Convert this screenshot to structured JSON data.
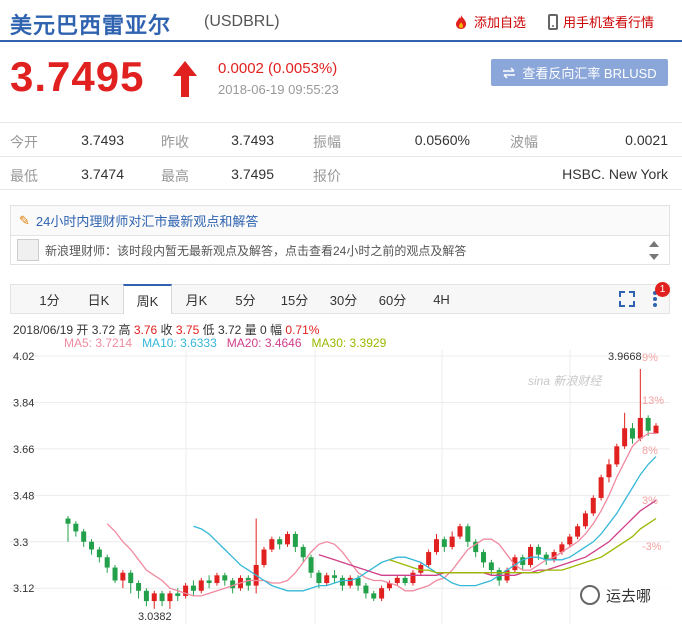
{
  "header": {
    "title": "美元巴西雷亚尔",
    "code": "(USDBRL)",
    "add_watchlist": "添加自选",
    "mobile_view": "用手机查看行情"
  },
  "quote": {
    "price": "3.7495",
    "change": "0.0002 (0.0053%)",
    "time": "2018-06-19 09:55:23",
    "reverse_button": "查看反向汇率 BRLUSD",
    "up_color": "#e0211f"
  },
  "stats": {
    "rows": [
      [
        {
          "label": "今开",
          "value": "3.7493"
        },
        {
          "label": "昨收",
          "value": "3.7493"
        },
        {
          "label": "振幅",
          "value": "0.0560%"
        },
        {
          "label": "波幅",
          "value": "0.0021"
        }
      ],
      [
        {
          "label": "最低",
          "value": "3.7474"
        },
        {
          "label": "最高",
          "value": "3.7495"
        },
        {
          "label": "报价",
          "value": "HSBC. New York"
        }
      ]
    ]
  },
  "opinions": {
    "heading": "24小时内理财师对汇市最新观点和解答",
    "message": "新浪理财师：该时段内暂无最新观点及解答，点击查看24小时之前的观点及解答"
  },
  "tabs": {
    "items": [
      "1分",
      "日K",
      "周K",
      "月K",
      "5分",
      "15分",
      "30分",
      "60分",
      "4H"
    ],
    "active": "周K",
    "badge": "1"
  },
  "kline_info": {
    "date": "2018/06/19",
    "open_label": "开",
    "open": "3.72",
    "high_label": "高",
    "high": "3.76",
    "close_label": "收",
    "close": "3.75",
    "low_label": "低",
    "low": "3.72",
    "vol_label": "量",
    "vol": "0",
    "amp_label": "幅",
    "amp": "0.71%",
    "ma5": "MA5: 3.7214",
    "ma10": "MA10: 3.6333",
    "ma20": "MA20: 3.4646",
    "ma30": "MA30: 3.3929",
    "ma_colors": {
      "ma5": "#f08aa0",
      "ma10": "#36b8d8",
      "ma20": "#d0408a",
      "ma30": "#9ab800"
    }
  },
  "watermark": {
    "brand": "sina 新浪财经",
    "account": "运去哪"
  },
  "chart_data": {
    "type": "candlestick",
    "title": "",
    "y_ticks": [
      "4.02",
      "3.84",
      "3.66",
      "3.48",
      "3.3",
      "3.12"
    ],
    "y_range": [
      3.02,
      4.02
    ],
    "right_ticks": [
      "9%",
      "13%",
      "8%",
      "3%",
      "-3%"
    ],
    "high_label": "3.9668",
    "low_label": "3.0382",
    "up_color": "#e0211f",
    "down_color": "#22a04a",
    "candles": [
      [
        3.39,
        3.37,
        3.4,
        3.3
      ],
      [
        3.37,
        3.34,
        3.38,
        3.32
      ],
      [
        3.34,
        3.3,
        3.35,
        3.28
      ],
      [
        3.3,
        3.27,
        3.31,
        3.25
      ],
      [
        3.27,
        3.24,
        3.28,
        3.22
      ],
      [
        3.24,
        3.2,
        3.25,
        3.18
      ],
      [
        3.2,
        3.15,
        3.21,
        3.14
      ],
      [
        3.15,
        3.18,
        3.19,
        3.12
      ],
      [
        3.18,
        3.14,
        3.19,
        3.1
      ],
      [
        3.14,
        3.11,
        3.15,
        3.08
      ],
      [
        3.11,
        3.07,
        3.12,
        3.05
      ],
      [
        3.07,
        3.1,
        3.11,
        3.04
      ],
      [
        3.1,
        3.07,
        3.11,
        3.05
      ],
      [
        3.07,
        3.1,
        3.11,
        3.04
      ],
      [
        3.1,
        3.09,
        3.12,
        3.07
      ],
      [
        3.09,
        3.13,
        3.14,
        3.08
      ],
      [
        3.13,
        3.11,
        3.15,
        3.09
      ],
      [
        3.11,
        3.15,
        3.16,
        3.1
      ],
      [
        3.15,
        3.14,
        3.17,
        3.12
      ],
      [
        3.14,
        3.17,
        3.18,
        3.13
      ],
      [
        3.17,
        3.15,
        3.18,
        3.13
      ],
      [
        3.15,
        3.12,
        3.16,
        3.1
      ],
      [
        3.12,
        3.16,
        3.17,
        3.11
      ],
      [
        3.16,
        3.13,
        3.17,
        3.11
      ],
      [
        3.13,
        3.21,
        3.39,
        3.1
      ],
      [
        3.21,
        3.27,
        3.28,
        3.2
      ],
      [
        3.27,
        3.31,
        3.32,
        3.26
      ],
      [
        3.31,
        3.29,
        3.32,
        3.27
      ],
      [
        3.29,
        3.33,
        3.34,
        3.28
      ],
      [
        3.33,
        3.28,
        3.34,
        3.26
      ],
      [
        3.28,
        3.24,
        3.29,
        3.22
      ],
      [
        3.24,
        3.18,
        3.25,
        3.16
      ],
      [
        3.18,
        3.14,
        3.19,
        3.12
      ],
      [
        3.14,
        3.17,
        3.18,
        3.13
      ],
      [
        3.17,
        3.16,
        3.19,
        3.14
      ],
      [
        3.16,
        3.13,
        3.17,
        3.11
      ],
      [
        3.13,
        3.16,
        3.17,
        3.12
      ],
      [
        3.16,
        3.13,
        3.17,
        3.11
      ],
      [
        3.13,
        3.1,
        3.14,
        3.08
      ],
      [
        3.1,
        3.08,
        3.11,
        3.07
      ],
      [
        3.08,
        3.12,
        3.13,
        3.07
      ],
      [
        3.12,
        3.14,
        3.15,
        3.11
      ],
      [
        3.14,
        3.16,
        3.17,
        3.13
      ],
      [
        3.16,
        3.14,
        3.17,
        3.13
      ],
      [
        3.14,
        3.18,
        3.19,
        3.13
      ],
      [
        3.18,
        3.21,
        3.22,
        3.17
      ],
      [
        3.21,
        3.26,
        3.27,
        3.2
      ],
      [
        3.26,
        3.31,
        3.33,
        3.25
      ],
      [
        3.31,
        3.28,
        3.32,
        3.26
      ],
      [
        3.28,
        3.32,
        3.34,
        3.27
      ],
      [
        3.32,
        3.36,
        3.37,
        3.31
      ],
      [
        3.36,
        3.3,
        3.37,
        3.28
      ],
      [
        3.3,
        3.26,
        3.31,
        3.24
      ],
      [
        3.26,
        3.22,
        3.27,
        3.2
      ],
      [
        3.22,
        3.19,
        3.23,
        3.17
      ],
      [
        3.19,
        3.15,
        3.2,
        3.13
      ],
      [
        3.15,
        3.19,
        3.2,
        3.14
      ],
      [
        3.19,
        3.24,
        3.25,
        3.18
      ],
      [
        3.24,
        3.21,
        3.25,
        3.19
      ],
      [
        3.21,
        3.28,
        3.29,
        3.2
      ],
      [
        3.28,
        3.25,
        3.29,
        3.23
      ],
      [
        3.25,
        3.23,
        3.26,
        3.21
      ],
      [
        3.23,
        3.26,
        3.27,
        3.22
      ],
      [
        3.26,
        3.29,
        3.3,
        3.25
      ],
      [
        3.29,
        3.32,
        3.33,
        3.28
      ],
      [
        3.32,
        3.36,
        3.37,
        3.31
      ],
      [
        3.36,
        3.41,
        3.42,
        3.35
      ],
      [
        3.41,
        3.47,
        3.48,
        3.4
      ],
      [
        3.47,
        3.55,
        3.56,
        3.46
      ],
      [
        3.55,
        3.6,
        3.62,
        3.53
      ],
      [
        3.6,
        3.67,
        3.68,
        3.59
      ],
      [
        3.67,
        3.74,
        3.8,
        3.66
      ],
      [
        3.74,
        3.7,
        3.76,
        3.68
      ],
      [
        3.7,
        3.78,
        3.97,
        3.69
      ],
      [
        3.78,
        3.73,
        3.79,
        3.71
      ],
      [
        3.72,
        3.75,
        3.76,
        3.72
      ]
    ],
    "ma_lines": {
      "MA5": [
        3.37,
        3.34,
        3.3,
        3.27,
        3.23,
        3.19,
        3.17,
        3.15,
        3.12,
        3.11,
        3.1,
        3.09,
        3.09,
        3.1,
        3.11,
        3.12,
        3.13,
        3.14,
        3.15,
        3.15,
        3.15,
        3.14,
        3.14,
        3.15,
        3.18,
        3.22,
        3.26,
        3.29,
        3.3,
        3.29,
        3.26,
        3.22,
        3.18,
        3.16,
        3.15,
        3.15,
        3.14,
        3.13,
        3.11,
        3.11,
        3.12,
        3.13,
        3.15,
        3.16,
        3.19,
        3.23,
        3.27,
        3.29,
        3.31,
        3.31,
        3.29,
        3.25,
        3.21,
        3.19,
        3.19,
        3.21,
        3.23,
        3.24,
        3.26,
        3.28,
        3.3,
        3.33,
        3.37,
        3.42,
        3.48,
        3.55,
        3.61,
        3.67,
        3.7,
        3.72,
        3.72
      ],
      "MA10": [
        3.36,
        3.35,
        3.33,
        3.3,
        3.27,
        3.24,
        3.21,
        3.19,
        3.17,
        3.15,
        3.13,
        3.12,
        3.11,
        3.11,
        3.11,
        3.12,
        3.13,
        3.13,
        3.14,
        3.15,
        3.15,
        3.16,
        3.18,
        3.2,
        3.22,
        3.23,
        3.24,
        3.24,
        3.23,
        3.22,
        3.2,
        3.18,
        3.16,
        3.14,
        3.13,
        3.13,
        3.13,
        3.14,
        3.15,
        3.17,
        3.19,
        3.21,
        3.23,
        3.24,
        3.24,
        3.23,
        3.23,
        3.23,
        3.24,
        3.26,
        3.28,
        3.3,
        3.33,
        3.37,
        3.41,
        3.46,
        3.51,
        3.56,
        3.6,
        3.63
      ],
      "MA20": [
        3.25,
        3.24,
        3.23,
        3.22,
        3.21,
        3.2,
        3.19,
        3.18,
        3.17,
        3.17,
        3.17,
        3.17,
        3.17,
        3.17,
        3.17,
        3.17,
        3.18,
        3.18,
        3.18,
        3.18,
        3.18,
        3.18,
        3.17,
        3.17,
        3.17,
        3.17,
        3.18,
        3.18,
        3.19,
        3.19,
        3.2,
        3.21,
        3.22,
        3.23,
        3.24,
        3.26,
        3.28,
        3.3,
        3.33,
        3.36,
        3.39,
        3.42,
        3.44,
        3.46
      ],
      "MA30": [
        3.23,
        3.22,
        3.21,
        3.2,
        3.19,
        3.19,
        3.18,
        3.18,
        3.18,
        3.18,
        3.18,
        3.18,
        3.18,
        3.18,
        3.18,
        3.18,
        3.18,
        3.18,
        3.18,
        3.18,
        3.19,
        3.19,
        3.19,
        3.2,
        3.21,
        3.22,
        3.23,
        3.24,
        3.26,
        3.28,
        3.3,
        3.32,
        3.35,
        3.37,
        3.39
      ]
    }
  }
}
